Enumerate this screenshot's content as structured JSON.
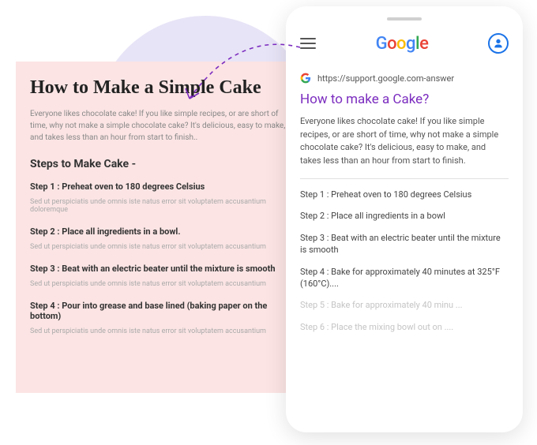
{
  "article": {
    "title": "How to Make a Simple Cake",
    "intro": "Everyone likes chocolate cake! If you like simple recipes, or are short of time, why not make a simple chocolate cake? It's delicious, easy to make, and takes less than an hour from start to finish..",
    "steps_heading": "Steps to Make Cake -",
    "steps": [
      {
        "title": "Step 1 : Preheat oven to 180 degrees Celsius",
        "desc": "Sed ut perspiciatis unde omnis iste natus error sit voluptatem accusantium doloremque"
      },
      {
        "title": "Step 2 : Place all ingredients in a bowl.",
        "desc": "Sed ut perspiciatis unde omnis iste natus error sit voluptatem accusantium"
      },
      {
        "title": "Step 3 : Beat with an electric beater until the mixture is smooth",
        "desc": "Sed ut perspiciatis unde omnis iste natus error sit voluptatem accusantium"
      },
      {
        "title": "Step 4 : Pour into grease and base lined (baking paper on the  bottom)",
        "desc": "Sed ut perspiciatis unde omnis iste natus error sit voluptatem accusantium"
      }
    ]
  },
  "phone": {
    "url": "https://support.google.com-answer",
    "result_title": "How to make a Cake?",
    "result_desc": "Everyone likes chocolate cake! If you like simple recipes, or are short of time, why not make a simple chocolate cake? It's delicious, easy to make, and takes less than an hour from start to finish.",
    "steps": [
      {
        "text": "Step 1 : Preheat oven to 180 degrees Celsius",
        "faded": false
      },
      {
        "text": "Step 2 : Place all ingredients in a bowl",
        "faded": false
      },
      {
        "text": "Step 3 : Beat with an electric beater until the mixture is smooth",
        "faded": false
      },
      {
        "text": "Step 4 : Bake for approximately 40 minutes at 325°F (160°C)....",
        "faded": false
      },
      {
        "text": "Step 5 : Bake for approximately 40 minu ...",
        "faded": true
      },
      {
        "text": "Step 6 : Place the mixing bowl out on ....",
        "faded": true
      }
    ]
  }
}
